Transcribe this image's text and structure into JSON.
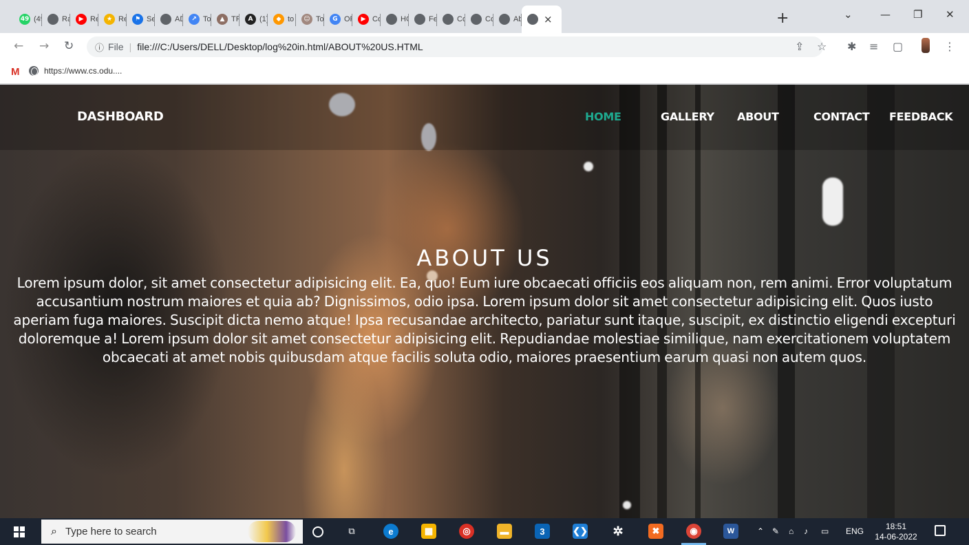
{
  "browser": {
    "tabs": [
      {
        "title": "(49",
        "icon": "whatsapp-icon",
        "color": "#25d366",
        "glyph": "49"
      },
      {
        "title": "Ra",
        "icon": "globe-icon",
        "color": "#5f6368",
        "glyph": ""
      },
      {
        "title": "Re",
        "icon": "youtube-icon",
        "color": "#ff0000",
        "glyph": "▶"
      },
      {
        "title": "Re",
        "icon": "star-app-icon",
        "color": "#f4b400",
        "glyph": "★"
      },
      {
        "title": "Se",
        "icon": "flag-icon",
        "color": "#1a73e8",
        "glyph": "⚑"
      },
      {
        "title": "AD",
        "icon": "globe-icon",
        "color": "#5f6368",
        "glyph": ""
      },
      {
        "title": "To",
        "icon": "trend-icon",
        "color": "#4285f4",
        "glyph": "↗"
      },
      {
        "title": "TR",
        "icon": "building-icon",
        "color": "#8d6e63",
        "glyph": "▲"
      },
      {
        "title": "(1)",
        "icon": "letter-a-icon",
        "color": "#222222",
        "glyph": "A"
      },
      {
        "title": "to",
        "icon": "app-icon",
        "color": "#ff9800",
        "glyph": "◆"
      },
      {
        "title": "To",
        "icon": "avatar-icon",
        "color": "#a1887f",
        "glyph": "☺"
      },
      {
        "title": "OF",
        "icon": "google-icon",
        "color": "#4285f4",
        "glyph": "G"
      },
      {
        "title": "Co",
        "icon": "youtube-icon",
        "color": "#ff0000",
        "glyph": "▶"
      },
      {
        "title": "HC",
        "icon": "globe-icon",
        "color": "#5f6368",
        "glyph": ""
      },
      {
        "title": "Fe",
        "icon": "globe-icon",
        "color": "#5f6368",
        "glyph": ""
      },
      {
        "title": "Co",
        "icon": "globe-icon",
        "color": "#5f6368",
        "glyph": ""
      },
      {
        "title": "Co",
        "icon": "globe-icon",
        "color": "#5f6368",
        "glyph": ""
      },
      {
        "title": "Ab",
        "icon": "globe-icon",
        "color": "#5f6368",
        "glyph": ""
      }
    ],
    "active_tab": {
      "title": "",
      "icon": "globe-icon",
      "close": "×"
    },
    "new_tab": "+",
    "address": {
      "info_icon": "ⓘ",
      "scheme_label": "File",
      "url": "file:///C:/Users/DELL/Desktop/log%20in.html/ABOUT%20US.HTML"
    },
    "bookmarks": [
      {
        "label": "https://www.cs.odu...."
      }
    ]
  },
  "site": {
    "brand": "DASHBOARD",
    "nav": [
      {
        "label": "HOME",
        "active": true
      },
      {
        "label": "GALLERY",
        "active": false
      },
      {
        "label": "ABOUT",
        "active": false
      },
      {
        "label": "CONTACT",
        "active": false
      },
      {
        "label": "FEEDBACK",
        "active": false
      }
    ],
    "accent_color": "#1ea98f",
    "hero_title": "ABOUT US",
    "hero_text": "Lorem ipsum dolor, sit amet consectetur adipisicing elit. Ea, quo! Eum iure obcaecati officiis eos aliquam non, rem animi. Error voluptatum accusantium nostrum maiores et quia ab? Dignissimos, odio ipsa. Lorem ipsum dolor sit amet consectetur adipisicing elit. Quos iusto aperiam fuga maiores. Suscipit dicta nemo atque! Ipsa recusandae architecto, pariatur sunt itaque, suscipit, ex distinctio eligendi excepturi doloremque a! Lorem ipsum dolor sit amet consectetur adipisicing elit. Repudiandae molestiae similique, nam exercitationem voluptatem obcaecati at amet nobis quibusdam atque facilis soluta odio, maiores praesentium earum quasi non autem quos."
  },
  "taskbar": {
    "search_placeholder": "Type here to search",
    "mail_badge": "3",
    "tray_language": "ENG",
    "time": "18:51",
    "date": "14-06-2022"
  }
}
